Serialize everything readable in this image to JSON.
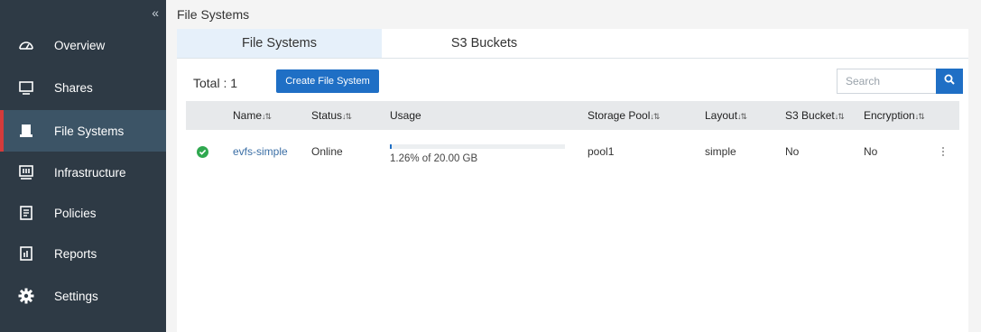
{
  "sidebar": {
    "collapse_glyph": "«",
    "items": [
      {
        "label": "Overview",
        "icon": "dashboard-icon",
        "active": false
      },
      {
        "label": "Shares",
        "icon": "monitor-icon",
        "active": false
      },
      {
        "label": "File Systems",
        "icon": "file-systems-icon",
        "active": true
      },
      {
        "label": "Infrastructure",
        "icon": "server-icon",
        "active": false
      },
      {
        "label": "Policies",
        "icon": "document-icon",
        "active": false
      },
      {
        "label": "Reports",
        "icon": "report-icon",
        "active": false
      },
      {
        "label": "Settings",
        "icon": "gear-icon",
        "active": false
      }
    ],
    "active_marker_color": "#d43b3b"
  },
  "header": {
    "title": "File Systems"
  },
  "tabs": [
    {
      "label": "File Systems",
      "active": true
    },
    {
      "label": "S3 Buckets",
      "active": false
    }
  ],
  "toolbar": {
    "total_label": "Total : 1",
    "create_label": "Create File System",
    "search_placeholder": "Search"
  },
  "table": {
    "columns": [
      "Name",
      "Status",
      "Usage",
      "Storage Pool",
      "Layout",
      "S3 Bucket",
      "Encryption"
    ],
    "rows": [
      {
        "status_icon": "check-circle-icon",
        "name": "evfs-simple",
        "status": "Online",
        "usage_text": "1.26% of 20.00 GB",
        "usage_fraction": 0.0126,
        "storage_pool": "pool1",
        "layout": "simple",
        "s3_bucket": "No",
        "encryption": "No"
      }
    ]
  },
  "colors": {
    "accent": "#1f6fc5",
    "sidebar": "#2e3a45",
    "success": "#2fa84f"
  }
}
